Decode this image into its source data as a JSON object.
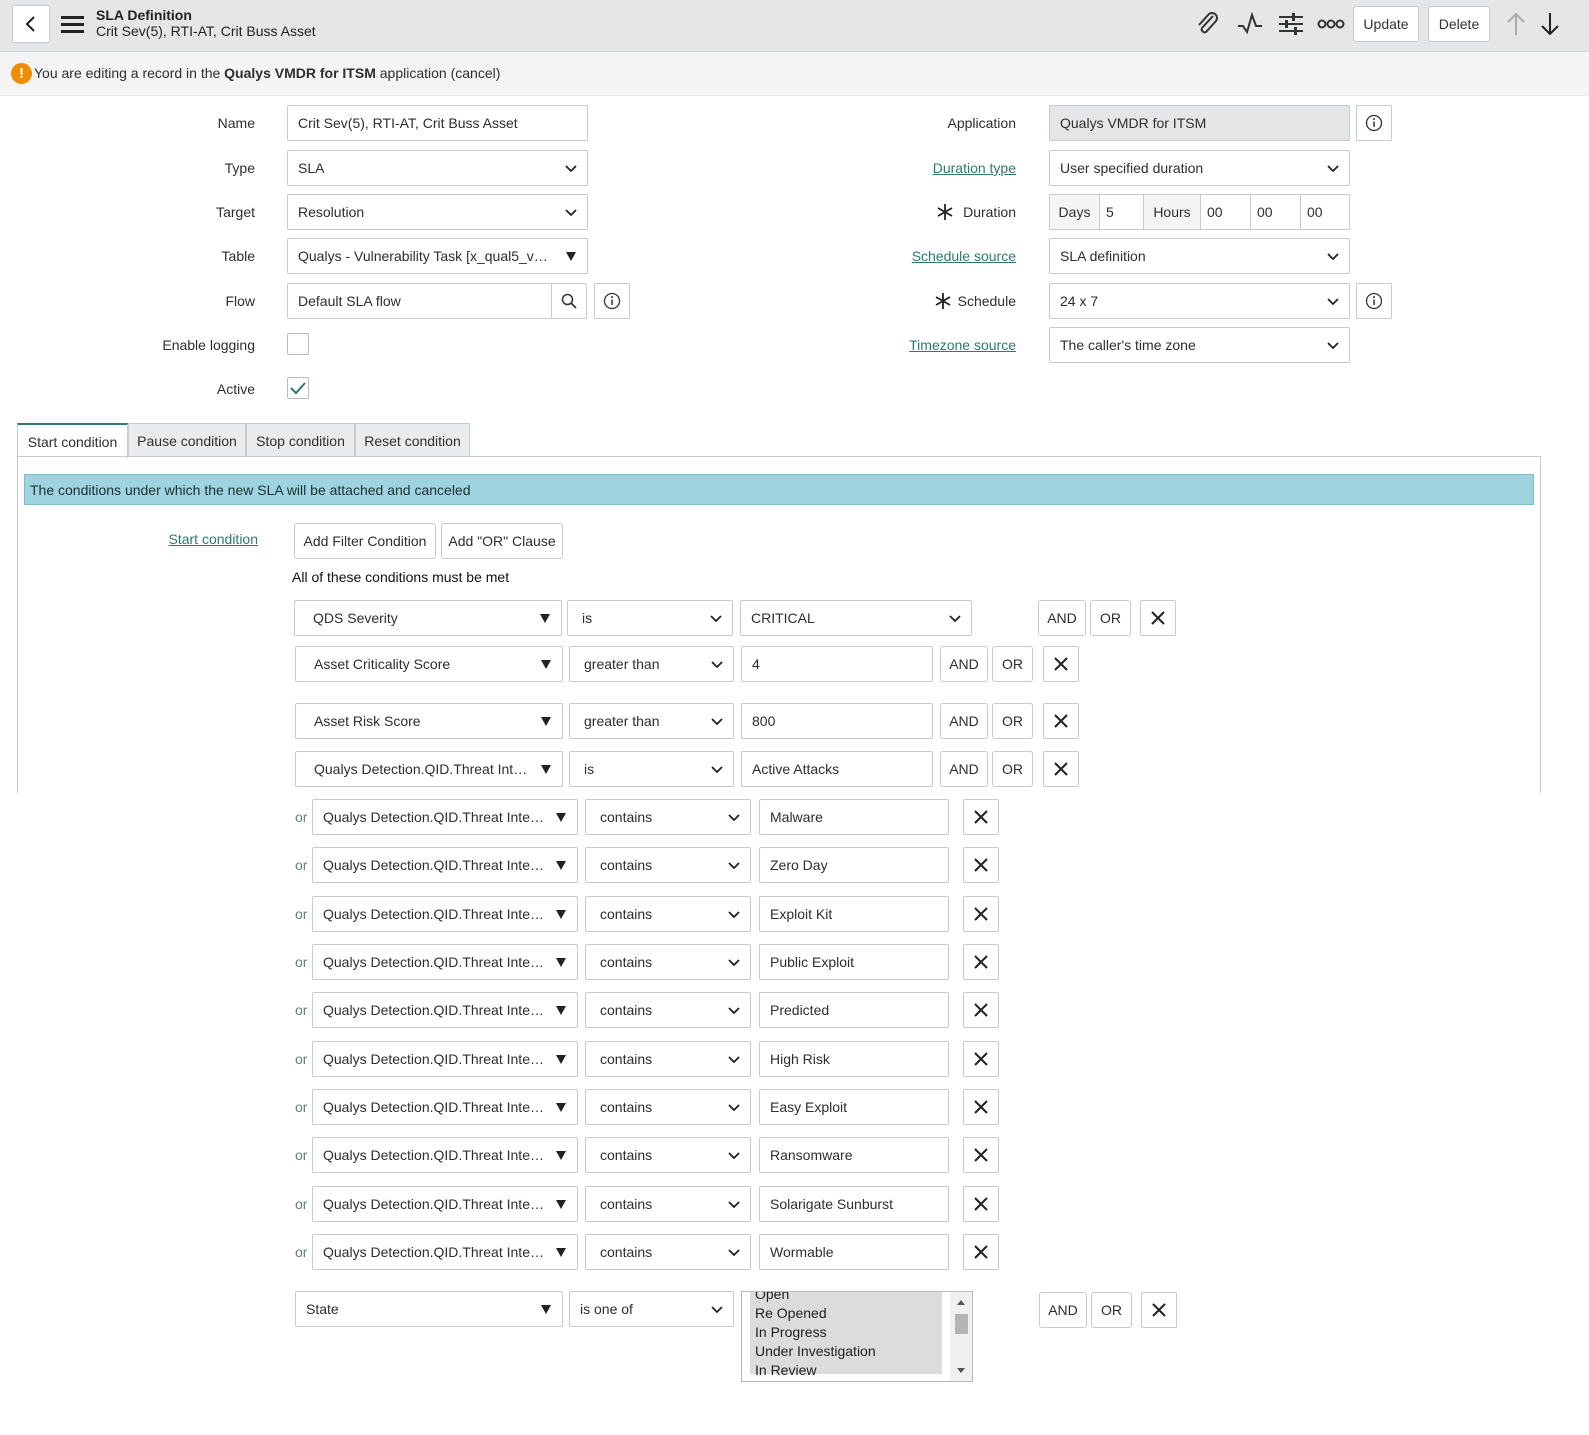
{
  "header": {
    "title": "SLA Definition",
    "subtitle": "Crit Sev(5), RTI-AT, Crit Buss Asset",
    "update_label": "Update",
    "delete_label": "Delete"
  },
  "notice": {
    "prefix": "You are editing a record in the ",
    "app_name": "Qualys VMDR for ITSM",
    "suffix": " application ",
    "cancel": "(cancel)"
  },
  "form": {
    "left": {
      "name_label": "Name",
      "name_value": "Crit Sev(5), RTI-AT, Crit Buss Asset",
      "type_label": "Type",
      "type_value": "SLA",
      "target_label": "Target",
      "target_value": "Resolution",
      "table_label": "Table",
      "table_value": "Qualys - Vulnerability Task [x_qual5_vmd...",
      "flow_label": "Flow",
      "flow_value": "Default SLA flow",
      "logging_label": "Enable logging",
      "logging_checked": false,
      "active_label": "Active",
      "active_checked": true
    },
    "right": {
      "application_label": "Application",
      "application_value": "Qualys VMDR for ITSM",
      "duration_type_label": "Duration type",
      "duration_type_value": "User specified duration",
      "duration_label": "Duration",
      "days_label": "Days",
      "days_value": "5",
      "hours_label": "Hours",
      "hours_value": "00",
      "minutes_value": "00",
      "seconds_value": "00",
      "schedule_source_label": "Schedule source",
      "schedule_source_value": "SLA definition",
      "schedule_label": "Schedule",
      "schedule_value": "24 x 7",
      "timezone_source_label": "Timezone source",
      "timezone_source_value": "The caller's time zone"
    }
  },
  "tabs": [
    {
      "label": "Start condition",
      "active": true
    },
    {
      "label": "Pause condition",
      "active": false
    },
    {
      "label": "Stop condition",
      "active": false
    },
    {
      "label": "Reset condition",
      "active": false
    }
  ],
  "tab_info": "The conditions under which the new SLA will be attached and canceled",
  "condition": {
    "label": "Start condition",
    "add_filter": "Add Filter Condition",
    "add_or": "Add \"OR\" Clause",
    "must_be_met": "All of these conditions must be met",
    "and_label": "AND",
    "or_button": "OR",
    "or_prefix": "or",
    "rows": [
      {
        "field": "QDS Severity",
        "operator": "is",
        "value": "CRITICAL"
      },
      {
        "field": "Asset Criticality Score",
        "operator": "greater than",
        "value": "4"
      },
      {
        "field": "Asset Risk Score",
        "operator": "greater than",
        "value": "800"
      },
      {
        "field": "Qualys Detection.QID.Threat Intelli...",
        "operator": "is",
        "value": "Active Attacks"
      }
    ],
    "or_rows": [
      {
        "field": "Qualys Detection.QID.Threat Intelli...",
        "operator": "contains",
        "value": "Malware"
      },
      {
        "field": "Qualys Detection.QID.Threat Intelli...",
        "operator": "contains",
        "value": "Zero Day"
      },
      {
        "field": "Qualys Detection.QID.Threat Intelli...",
        "operator": "contains",
        "value": "Exploit Kit"
      },
      {
        "field": "Qualys Detection.QID.Threat Intelli...",
        "operator": "contains",
        "value": "Public Exploit"
      },
      {
        "field": "Qualys Detection.QID.Threat Intelli...",
        "operator": "contains",
        "value": "Predicted"
      },
      {
        "field": "Qualys Detection.QID.Threat Intelli...",
        "operator": "contains",
        "value": "High Risk"
      },
      {
        "field": "Qualys Detection.QID.Threat Intelli...",
        "operator": "contains",
        "value": "Easy Exploit"
      },
      {
        "field": "Qualys Detection.QID.Threat Intelli...",
        "operator": "contains",
        "value": "Ransomware"
      },
      {
        "field": "Qualys Detection.QID.Threat Intelli...",
        "operator": "contains",
        "value": "Solarigate Sunburst"
      },
      {
        "field": "Qualys Detection.QID.Threat Intelli...",
        "operator": "contains",
        "value": "Wormable"
      }
    ],
    "state_row": {
      "field": "State",
      "operator": "is one of",
      "options": [
        "Open",
        "Re Opened",
        "In Progress",
        "Under Investigation",
        "In Review"
      ]
    }
  },
  "colors": {
    "accent": "#2e7a6b",
    "info_bar": "#9dd4df",
    "warning": "#f08c00",
    "header_bg": "#e4e6e7"
  }
}
